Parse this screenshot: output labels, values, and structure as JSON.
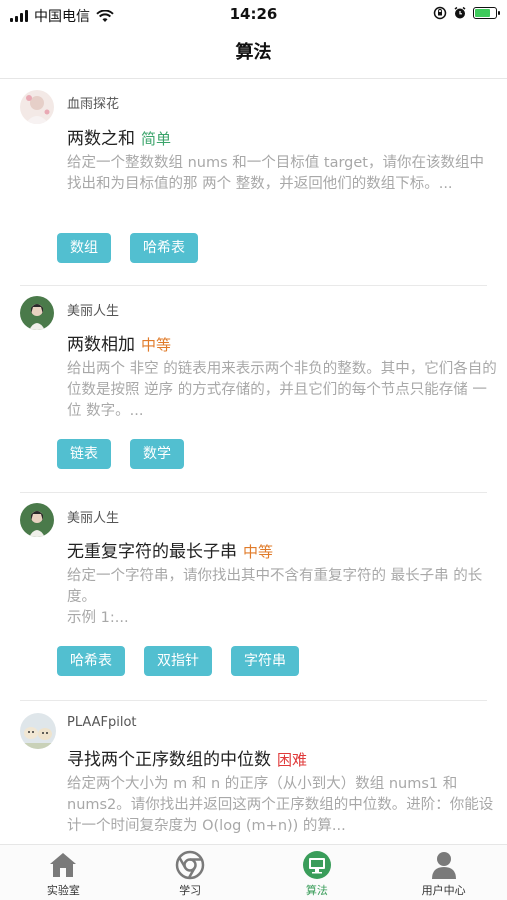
{
  "status": {
    "carrier": "中国电信",
    "time": "14:26"
  },
  "nav": {
    "title": "算法"
  },
  "colors": {
    "tag": "#52bfd0",
    "easy": "#3aa36a",
    "medium": "#e07b2a",
    "hard": "#e03a3a"
  },
  "problems": [
    {
      "author": "血雨探花",
      "title": "两数之和",
      "difficulty": "简单",
      "desc": "给定一个整数数组 nums 和一个目标值 target，请你在该数组中找出和为目标值的那 两个 整数，并返回他们的数组下标。...",
      "tags": [
        "数组",
        "哈希表"
      ]
    },
    {
      "author": "美丽人生",
      "title": "两数相加",
      "difficulty": "中等",
      "desc": "给出两个 非空 的链表用来表示两个非负的整数。其中，它们各自的位数是按照 逆序 的方式存储的，并且它们的每个节点只能存储 一位 数字。...",
      "tags": [
        "链表",
        "数学"
      ]
    },
    {
      "author": "美丽人生",
      "title": "无重复字符的最长子串",
      "difficulty": "中等",
      "desc": "给定一个字符串，请你找出其中不含有重复字符的 最长子串 的长度。\n示例 1:...",
      "tags": [
        "哈希表",
        "双指针",
        "字符串"
      ]
    },
    {
      "author": "PLAAFpilot",
      "title": "寻找两个正序数组的中位数",
      "difficulty": "困难",
      "desc": "给定两个大小为 m 和 n 的正序（从小到大）数组 nums1 和 nums2。请你找出并返回这两个正序数组的中位数。进阶：你能设计一个时间复杂度为 O(log (m+n)) 的算...",
      "tags": []
    }
  ],
  "tabs": [
    {
      "label": "实验室",
      "icon": "home-icon"
    },
    {
      "label": "学习",
      "icon": "chrome-icon"
    },
    {
      "label": "算法",
      "icon": "monitor-icon"
    },
    {
      "label": "用户中心",
      "icon": "user-icon"
    }
  ]
}
